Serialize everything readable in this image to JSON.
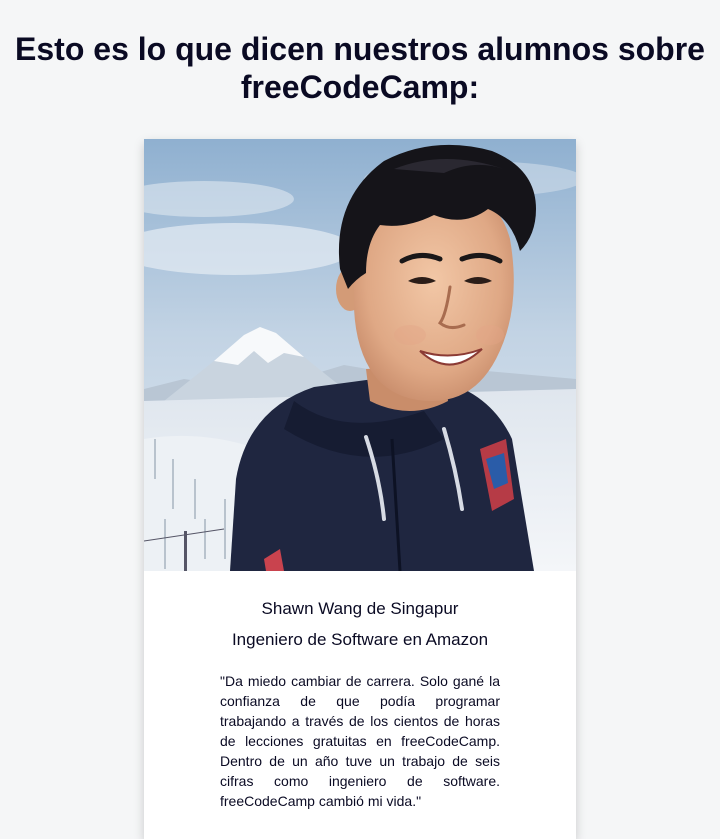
{
  "section": {
    "heading": "Esto es lo que dicen nuestros alumnos sobre freeCodeCamp:"
  },
  "testimonial": {
    "photo_alt": "Shawn Wang",
    "name_line": "Shawn Wang de Singapur",
    "role_line": "Ingeniero de Software en Amazon",
    "quote": "\"Da miedo cambiar de carrera. Solo gané la confianza de que podía programar trabajando a través de los cientos de horas de lecciones gratuitas en freeCodeCamp. Dentro de un año tuve un trabajo de seis cifras como ingeniero de software. freeCodeCamp cambió mi vida.\""
  }
}
